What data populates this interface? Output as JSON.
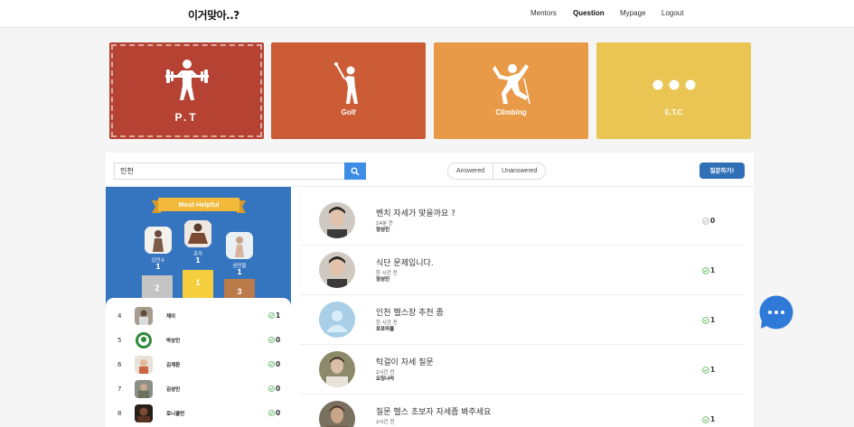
{
  "nav": {
    "logo": "이거맞아..?",
    "links": [
      "Mentors",
      "Question",
      "Mypage",
      "Logout"
    ],
    "active": "Question"
  },
  "categories": [
    {
      "label": "P.T",
      "icon": "weightlifting-icon",
      "color": "#b54233"
    },
    {
      "label": "Golf",
      "icon": "golf-icon",
      "color": "#cb5c36"
    },
    {
      "label": "Climbing",
      "icon": "climbing-icon",
      "color": "#e99a48"
    },
    {
      "label": "E.T.C",
      "icon": "ellipsis-icon",
      "color": "#eac553"
    }
  ],
  "search": {
    "value": "인천"
  },
  "filters": [
    "Answered",
    "Unanswered"
  ],
  "ask_button": "질문하기!",
  "most_helpful": {
    "title": "Most Helpful",
    "podium": [
      {
        "rank": "2",
        "name": "김민수",
        "count": "1"
      },
      {
        "rank": "1",
        "name": "조각",
        "count": "1"
      },
      {
        "rank": "3",
        "name": "성민들",
        "count": "1"
      }
    ],
    "list": [
      {
        "rank": "4",
        "name": "제이",
        "score": "1"
      },
      {
        "rank": "5",
        "name": "박상민",
        "score": "0"
      },
      {
        "rank": "6",
        "name": "김계환",
        "score": "0"
      },
      {
        "rank": "7",
        "name": "김성민",
        "score": "0"
      },
      {
        "rank": "8",
        "name": "로니콜먼",
        "score": "0"
      }
    ]
  },
  "questions": [
    {
      "title": "벤치 자세가 맞을까요 ?",
      "time": "14분 전",
      "author": "정성민",
      "answers": "0"
    },
    {
      "title": "식단 문제입니다.",
      "time": "한 시간 전",
      "author": "정성민",
      "answers": "1"
    },
    {
      "title": "인천 헬스장 추천 좀",
      "time": "한 시간 전",
      "author": "포포마을",
      "answers": "1"
    },
    {
      "title": "턱걸이 자세 질문",
      "time": "2시간 전",
      "author": "오징나라",
      "answers": "1"
    },
    {
      "title": "질문 헬스 초보자 자세좀 봐주세요",
      "time": "2시간 전",
      "author": "",
      "answers": "1"
    }
  ],
  "colors": {
    "accent": "#3575c0",
    "check": "#4caf50",
    "search": "#3d8de6"
  }
}
